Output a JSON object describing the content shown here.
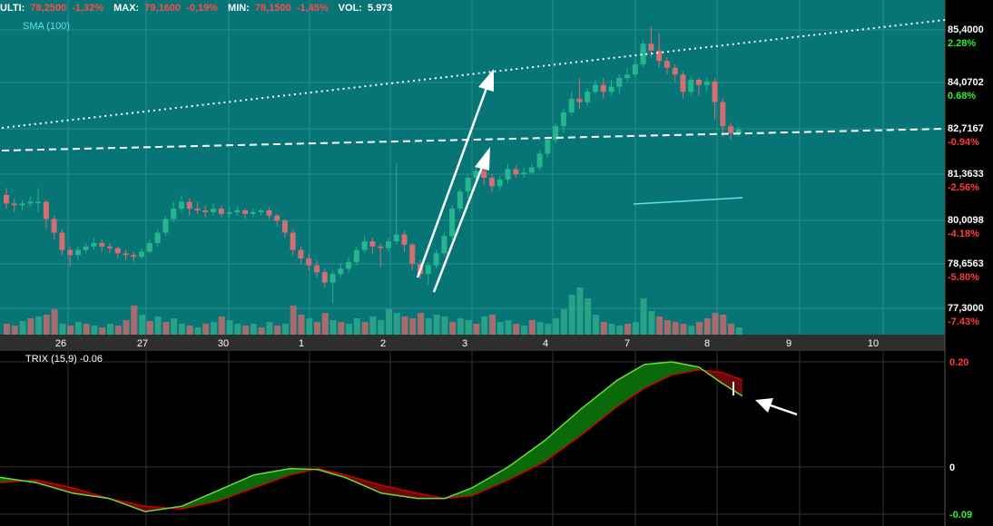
{
  "header": {
    "items": [
      {
        "label": "ULTI:",
        "value": "78,2500",
        "change": "-1,32%"
      },
      {
        "label": "MAX:",
        "value": "79,1600",
        "change": "-0,19%"
      },
      {
        "label": "MIN:",
        "value": "78,1500",
        "change": "-1,45%"
      },
      {
        "label": "VOL:",
        "value": "5.973",
        "change": ""
      }
    ]
  },
  "colors": {
    "price_bg": "#077575",
    "up_candle": "#26b58f",
    "down_candle": "#d36f73",
    "volume_up": "#2fa88c",
    "volume_down": "#c46b6e",
    "grid": "#2b8f8d",
    "sma": "#5fe3ec",
    "trix_green": "#00aa00",
    "trix_red": "#cc0000",
    "trix_fill_green": "#0a6a0a",
    "trix_fill_red": "#6a0a0a",
    "positive_text": "#2ef02e",
    "negative_text": "#ff3b3b"
  },
  "chart_data": [
    {
      "type": "candlestick",
      "indicator_label": "SMA (100)",
      "ylim": [
        77.3,
        85.54
      ],
      "x_ticks": [
        "26",
        "27",
        "30",
        "1",
        "2",
        "3",
        "4",
        "7",
        "8",
        "9",
        "10"
      ],
      "y_ticks": [
        {
          "price": "85,4000",
          "pct": "2.28%"
        },
        {
          "price": "84,0702",
          "pct": "0.68%"
        },
        {
          "price": "82,7167",
          "pct": "-0.94%"
        },
        {
          "price": "81,3633",
          "pct": "-2.56%"
        },
        {
          "price": "80,0098",
          "pct": "-4.18%"
        },
        {
          "price": "78,6563",
          "pct": "-5.80%"
        },
        {
          "price": "77,3000",
          "pct": "-7.43%"
        }
      ],
      "candles": [
        [
          80.6,
          80.35,
          80.8,
          80.2
        ],
        [
          80.35,
          80.3,
          80.5,
          80.1
        ],
        [
          80.3,
          80.35,
          80.45,
          80.15
        ],
        [
          80.35,
          80.4,
          80.55,
          80.25
        ],
        [
          80.4,
          80.4,
          80.8,
          80.1
        ],
        [
          80.4,
          79.9,
          80.45,
          79.6
        ],
        [
          79.9,
          79.5,
          80.0,
          79.3
        ],
        [
          79.5,
          79.0,
          79.6,
          78.85
        ],
        [
          79.0,
          78.85,
          79.1,
          78.5
        ],
        [
          78.85,
          79.0,
          79.1,
          78.7
        ],
        [
          79.0,
          79.1,
          79.2,
          78.9
        ],
        [
          79.1,
          79.2,
          79.35,
          79.0
        ],
        [
          79.2,
          79.1,
          79.3,
          78.95
        ],
        [
          79.1,
          79.05,
          79.2,
          78.9
        ],
        [
          79.05,
          78.9,
          79.1,
          78.75
        ],
        [
          78.9,
          78.85,
          79.0,
          78.7
        ],
        [
          78.85,
          78.8,
          78.95,
          78.65
        ],
        [
          78.8,
          78.95,
          79.05,
          78.75
        ],
        [
          78.95,
          79.2,
          79.3,
          78.9
        ],
        [
          79.2,
          79.5,
          79.6,
          79.1
        ],
        [
          79.5,
          79.9,
          80.0,
          79.4
        ],
        [
          79.9,
          80.2,
          80.4,
          79.8
        ],
        [
          80.2,
          80.4,
          80.6,
          80.1
        ],
        [
          80.4,
          80.2,
          80.5,
          80.0
        ],
        [
          80.2,
          80.15,
          80.4,
          80.05
        ],
        [
          80.15,
          80.1,
          80.3,
          79.95
        ],
        [
          80.1,
          80.2,
          80.35,
          80.0
        ],
        [
          80.2,
          80.05,
          80.3,
          79.95
        ],
        [
          80.05,
          80.1,
          80.25,
          79.95
        ],
        [
          80.1,
          80.15,
          80.25,
          80.0
        ],
        [
          80.15,
          80.05,
          80.2,
          79.9
        ],
        [
          80.05,
          80.1,
          80.2,
          79.95
        ],
        [
          80.1,
          80.15,
          80.2,
          80.0
        ],
        [
          80.15,
          80.0,
          80.25,
          79.9
        ],
        [
          80.0,
          79.85,
          80.05,
          79.7
        ],
        [
          79.85,
          79.5,
          79.9,
          79.35
        ],
        [
          79.5,
          79.0,
          79.6,
          78.85
        ],
        [
          79.0,
          78.75,
          79.1,
          78.6
        ],
        [
          78.75,
          78.55,
          78.9,
          78.4
        ],
        [
          78.55,
          78.35,
          78.7,
          78.2
        ],
        [
          78.35,
          78.05,
          78.45,
          77.9
        ],
        [
          78.05,
          78.3,
          78.4,
          77.45
        ],
        [
          78.3,
          78.45,
          78.6,
          78.2
        ],
        [
          78.45,
          78.65,
          78.8,
          78.35
        ],
        [
          78.65,
          79.0,
          79.1,
          78.55
        ],
        [
          79.0,
          79.25,
          79.4,
          78.9
        ],
        [
          79.25,
          79.1,
          79.35,
          78.9
        ],
        [
          79.1,
          79.05,
          79.2,
          78.5
        ],
        [
          79.05,
          79.25,
          79.35,
          78.95
        ],
        [
          79.25,
          79.45,
          81.5,
          79.15
        ],
        [
          79.45,
          79.15,
          79.55,
          78.95
        ],
        [
          79.15,
          78.6,
          79.2,
          78.4
        ],
        [
          78.6,
          78.3,
          78.7,
          78.15
        ],
        [
          78.3,
          78.55,
          78.65,
          78.0
        ],
        [
          78.55,
          78.9,
          79.0,
          78.45
        ],
        [
          78.9,
          79.4,
          79.5,
          78.8
        ],
        [
          79.4,
          80.2,
          80.3,
          79.3
        ],
        [
          80.2,
          80.7,
          80.8,
          80.1
        ],
        [
          80.7,
          81.1,
          81.2,
          80.5
        ],
        [
          81.1,
          81.3,
          81.4,
          80.95
        ],
        [
          81.3,
          81.1,
          81.35,
          80.9
        ],
        [
          81.1,
          80.85,
          81.2,
          80.7
        ],
        [
          80.85,
          81.05,
          81.15,
          80.75
        ],
        [
          81.05,
          81.35,
          81.5,
          80.95
        ],
        [
          81.35,
          81.2,
          81.45,
          81.1
        ],
        [
          81.2,
          81.25,
          81.4,
          81.1
        ],
        [
          81.25,
          81.4,
          81.5,
          81.2
        ],
        [
          81.4,
          81.8,
          81.9,
          81.3
        ],
        [
          81.8,
          82.2,
          82.3,
          81.7
        ],
        [
          82.2,
          82.6,
          82.7,
          82.1
        ],
        [
          82.6,
          83.0,
          83.1,
          82.4
        ],
        [
          83.0,
          83.4,
          83.6,
          82.9
        ],
        [
          83.4,
          83.3,
          84.0,
          83.1
        ],
        [
          83.3,
          83.6,
          83.7,
          83.2
        ],
        [
          83.6,
          83.8,
          83.95,
          83.5
        ],
        [
          83.8,
          83.6,
          84.0,
          83.4
        ],
        [
          83.6,
          83.75,
          83.95,
          83.5
        ],
        [
          83.75,
          84.0,
          84.1,
          83.55
        ],
        [
          84.0,
          84.1,
          84.3,
          83.9
        ],
        [
          84.1,
          84.4,
          84.6,
          84.0
        ],
        [
          84.4,
          85.0,
          85.1,
          84.3
        ],
        [
          85.0,
          84.8,
          85.5,
          84.6
        ],
        [
          84.8,
          84.5,
          85.3,
          84.3
        ],
        [
          84.5,
          84.3,
          84.6,
          84.1
        ],
        [
          84.3,
          84.1,
          84.4,
          83.9
        ],
        [
          84.1,
          83.6,
          84.2,
          83.4
        ],
        [
          83.6,
          83.95,
          84.05,
          83.5
        ],
        [
          83.95,
          83.8,
          84.0,
          83.5
        ],
        [
          83.8,
          83.9,
          84.0,
          83.6
        ],
        [
          83.9,
          83.3,
          84.0,
          82.8
        ],
        [
          83.3,
          82.6,
          83.4,
          82.3
        ],
        [
          82.6,
          82.4,
          82.7,
          82.2
        ],
        [
          82.4,
          82.5,
          82.6,
          82.3
        ]
      ],
      "volumes": [
        [
          12,
          "down"
        ],
        [
          10,
          "down"
        ],
        [
          15,
          "up"
        ],
        [
          18,
          "down"
        ],
        [
          20,
          "up"
        ],
        [
          22,
          "down"
        ],
        [
          28,
          "down"
        ],
        [
          12,
          "up"
        ],
        [
          10,
          "down"
        ],
        [
          14,
          "up"
        ],
        [
          12,
          "down"
        ],
        [
          10,
          "up"
        ],
        [
          8,
          "down"
        ],
        [
          12,
          "up"
        ],
        [
          10,
          "down"
        ],
        [
          16,
          "down"
        ],
        [
          32,
          "down"
        ],
        [
          22,
          "up"
        ],
        [
          15,
          "down"
        ],
        [
          20,
          "up"
        ],
        [
          14,
          "down"
        ],
        [
          18,
          "up"
        ],
        [
          12,
          "up"
        ],
        [
          10,
          "down"
        ],
        [
          8,
          "up"
        ],
        [
          12,
          "down"
        ],
        [
          14,
          "up"
        ],
        [
          20,
          "down"
        ],
        [
          16,
          "up"
        ],
        [
          12,
          "up"
        ],
        [
          10,
          "down"
        ],
        [
          12,
          "up"
        ],
        [
          8,
          "down"
        ],
        [
          14,
          "up"
        ],
        [
          10,
          "down"
        ],
        [
          12,
          "up"
        ],
        [
          32,
          "down"
        ],
        [
          22,
          "down"
        ],
        [
          18,
          "up"
        ],
        [
          14,
          "down"
        ],
        [
          24,
          "down"
        ],
        [
          16,
          "up"
        ],
        [
          14,
          "down"
        ],
        [
          12,
          "up"
        ],
        [
          18,
          "up"
        ],
        [
          14,
          "down"
        ],
        [
          20,
          "up"
        ],
        [
          16,
          "up"
        ],
        [
          28,
          "up"
        ],
        [
          24,
          "up"
        ],
        [
          20,
          "down"
        ],
        [
          18,
          "down"
        ],
        [
          24,
          "down"
        ],
        [
          18,
          "up"
        ],
        [
          22,
          "up"
        ],
        [
          20,
          "up"
        ],
        [
          14,
          "down"
        ],
        [
          18,
          "up"
        ],
        [
          16,
          "up"
        ],
        [
          12,
          "down"
        ],
        [
          20,
          "up"
        ],
        [
          22,
          "down"
        ],
        [
          14,
          "up"
        ],
        [
          16,
          "up"
        ],
        [
          12,
          "down"
        ],
        [
          10,
          "up"
        ],
        [
          16,
          "down"
        ],
        [
          14,
          "up"
        ],
        [
          12,
          "up"
        ],
        [
          18,
          "up"
        ],
        [
          28,
          "up"
        ],
        [
          44,
          "up"
        ],
        [
          52,
          "up"
        ],
        [
          40,
          "up"
        ],
        [
          22,
          "up"
        ],
        [
          14,
          "down"
        ],
        [
          12,
          "up"
        ],
        [
          10,
          "up"
        ],
        [
          12,
          "down"
        ],
        [
          14,
          "up"
        ],
        [
          40,
          "up"
        ],
        [
          26,
          "up"
        ],
        [
          20,
          "down"
        ],
        [
          16,
          "down"
        ],
        [
          14,
          "down"
        ],
        [
          12,
          "down"
        ],
        [
          10,
          "up"
        ],
        [
          14,
          "down"
        ],
        [
          18,
          "down"
        ],
        [
          24,
          "down"
        ],
        [
          22,
          "down"
        ],
        [
          12,
          "down"
        ],
        [
          8,
          "up"
        ]
      ]
    },
    {
      "type": "line",
      "label": "TRIX (15,9) -0.06",
      "ylim": [
        -0.09,
        0.2
      ],
      "y_ticks": [
        "0.20",
        "0",
        "-0.09"
      ]
    }
  ]
}
